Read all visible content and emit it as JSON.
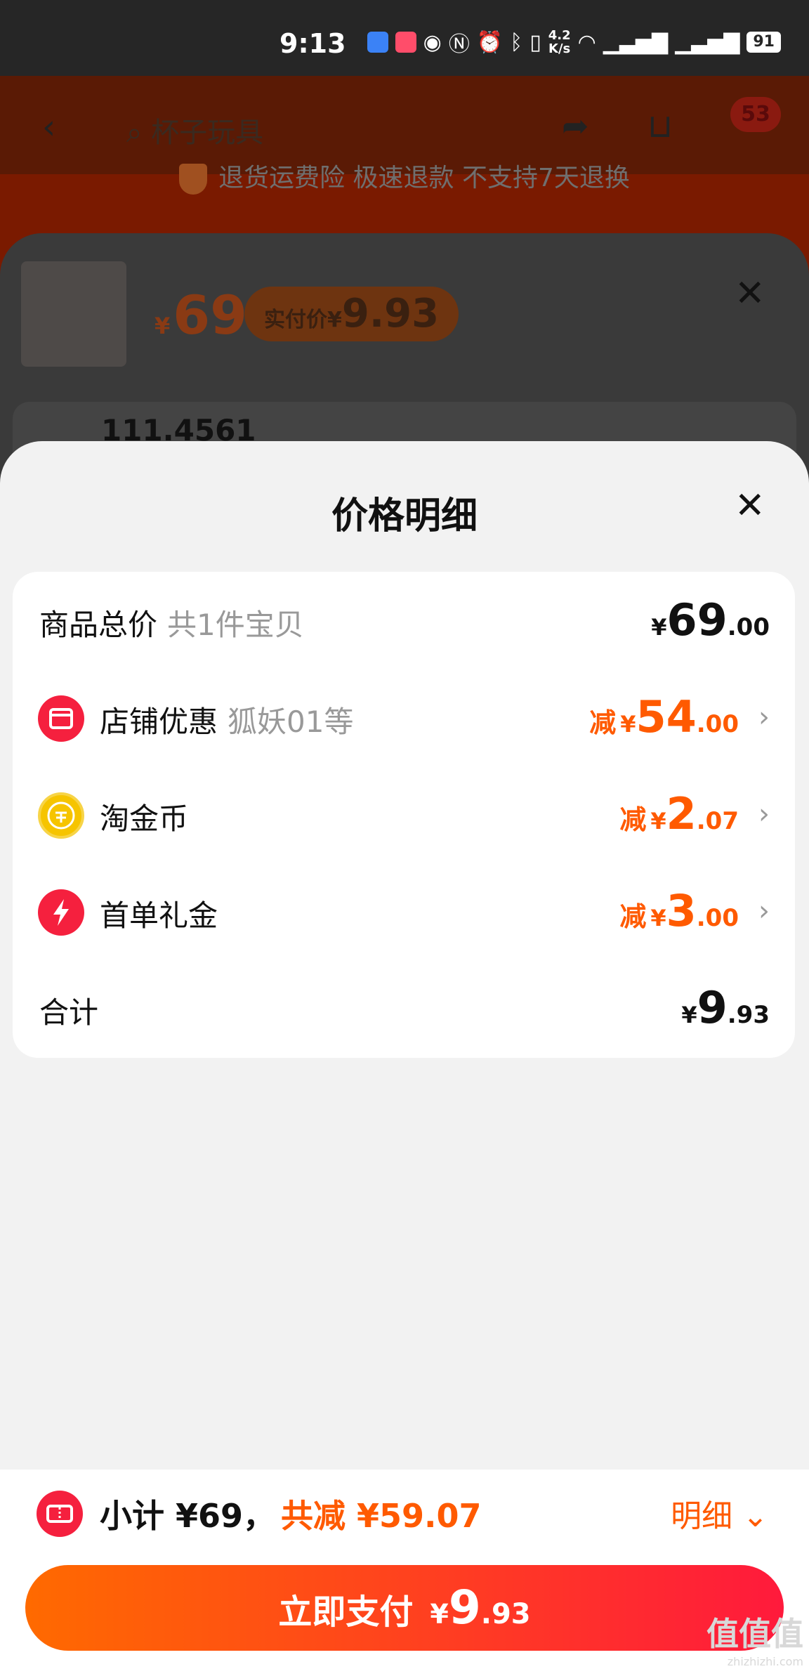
{
  "status_bar": {
    "time": "9:13",
    "speed_top": "4.2",
    "speed_bottom": "K/s",
    "battery": "91"
  },
  "background_page": {
    "search_text": "杯子玩具",
    "cart_badge": "53",
    "return_policy": "退货运费险 极速退款 不支持7天退换",
    "sheet_price_symbol": "¥",
    "sheet_price": "69",
    "sheet_actual_label": "实付价",
    "sheet_actual_symbol": "¥",
    "sheet_actual_price": "9.93",
    "sheet_number": "111.4561"
  },
  "sheet": {
    "title": "价格明细",
    "rows": [
      {
        "label": "商品总价",
        "sub": "共1件宝贝",
        "symbol": "¥",
        "int": "69",
        "dec": ".00"
      },
      {
        "label": "店铺优惠",
        "sub": "狐妖01等",
        "minus": "减",
        "symbol": "¥",
        "int": "54",
        "dec": ".00"
      },
      {
        "label": "淘金币",
        "sub": "",
        "minus": "减",
        "symbol": "¥",
        "int": "2",
        "dec": ".07"
      },
      {
        "label": "首单礼金",
        "sub": "",
        "minus": "减",
        "symbol": "¥",
        "int": "3",
        "dec": ".00"
      },
      {
        "label": "合计",
        "sub": "",
        "symbol": "¥",
        "int": "9",
        "dec": ".93"
      }
    ],
    "icons": [
      "shop-icon",
      "coin-icon",
      "lightning-icon"
    ],
    "colors": {
      "accent": "#ff5a00",
      "red": "#f5203e",
      "coin": "#f6c400"
    }
  },
  "bottom": {
    "subtotal": "小计 ¥69，",
    "total_minus": "共减 ¥59.07",
    "detail_label": "明细",
    "pay_label": "立即支付",
    "pay_symbol": "¥",
    "pay_int": "9",
    "pay_dec": ".93"
  },
  "watermark": {
    "text": "值值值",
    "url": "zhizhizhi.com"
  }
}
